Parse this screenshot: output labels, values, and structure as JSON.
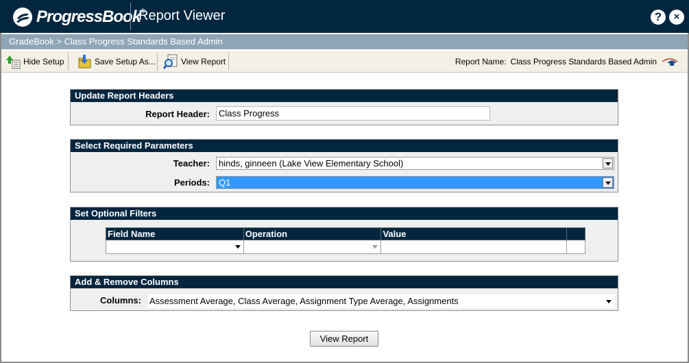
{
  "brand": {
    "logo_text": "ProgressBook",
    "registered_mark": "®"
  },
  "header": {
    "title": "Report Viewer",
    "help_icon": "?",
    "close_icon": "×"
  },
  "breadcrumb": {
    "text": "GradeBook > Class Progress Standards Based Admin"
  },
  "toolbar": {
    "hide_setup_label": "Hide Setup",
    "save_setup_label": "Save Setup As...",
    "view_report_label": "View Report",
    "report_name_label": "Report Name:",
    "report_name_value": "Class Progress Standards Based Admin"
  },
  "sections": {
    "headers": {
      "title": "Update Report Headers",
      "report_header_label": "Report Header:",
      "report_header_value": "Class Progress"
    },
    "params": {
      "title": "Select Required Parameters",
      "teacher_label": "Teacher:",
      "teacher_value": "hinds, ginneen (Lake View Elementary School)",
      "periods_label": "Periods:",
      "periods_value": "Q1"
    },
    "filters": {
      "title": "Set Optional Filters",
      "col_field": "Field Name",
      "col_operation": "Operation",
      "col_value": "Value"
    },
    "columns": {
      "title": "Add & Remove Columns",
      "columns_label": "Columns:",
      "columns_value": "Assessment Average, Class Average, Assignment Type Average, Assignments"
    }
  },
  "footer": {
    "view_report_button": "View Report"
  },
  "colors": {
    "navy": "#03263f",
    "breadcrumb": "#8ea5b6",
    "toolbar": "#f3f1e6",
    "selection": "#3399ff"
  }
}
